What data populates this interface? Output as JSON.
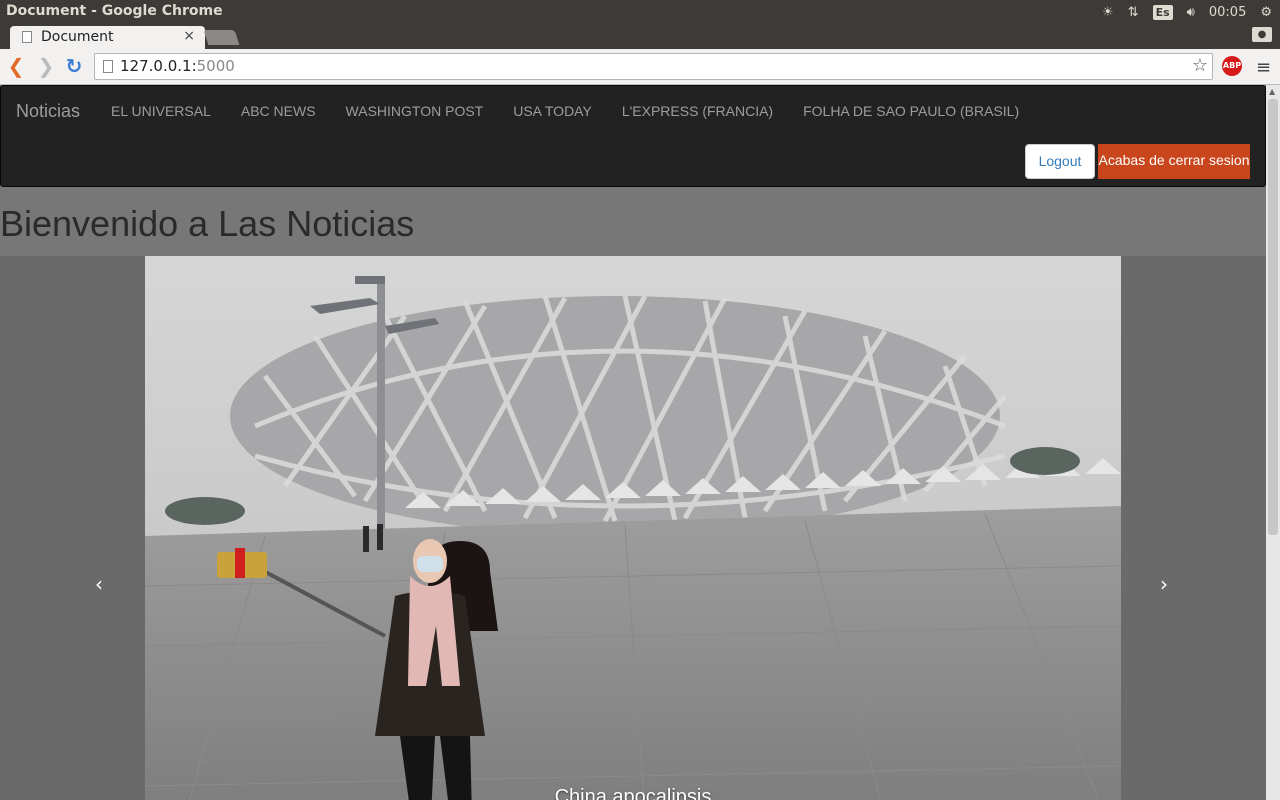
{
  "os": {
    "window_title": "Document - Google Chrome",
    "keyboard_layout": "Es",
    "clock": "00:05"
  },
  "browser": {
    "tab_title": "Document",
    "tab_close": "×",
    "url_host": "127.0.0.1:",
    "url_port": "5000",
    "adblock_label": "ABP",
    "star_glyph": "☆",
    "menu_glyph": "≡"
  },
  "navbar": {
    "brand": "Noticias",
    "links": [
      "EL UNIVERSAL",
      "ABC NEWS",
      "WASHINGTON POST",
      "USA TODAY",
      "L'EXPRESS (FRANCIA)",
      "FOLHA DE SAO PAULO (BRASIL)"
    ],
    "logout_label": "Logout",
    "alert_text": "Acabas de cerrar sesion"
  },
  "page": {
    "heading": "Bienvenido a Las Noticias"
  },
  "carousel": {
    "prev_glyph": "‹",
    "next_glyph": "›",
    "caption": "China apocalipsis",
    "image_subject": "woman-with-selfie-stick-bird-nest-stadium-smog"
  },
  "colors": {
    "navbar_bg": "#222222",
    "alert_bg": "#c9451b",
    "link": "#337ab7"
  }
}
